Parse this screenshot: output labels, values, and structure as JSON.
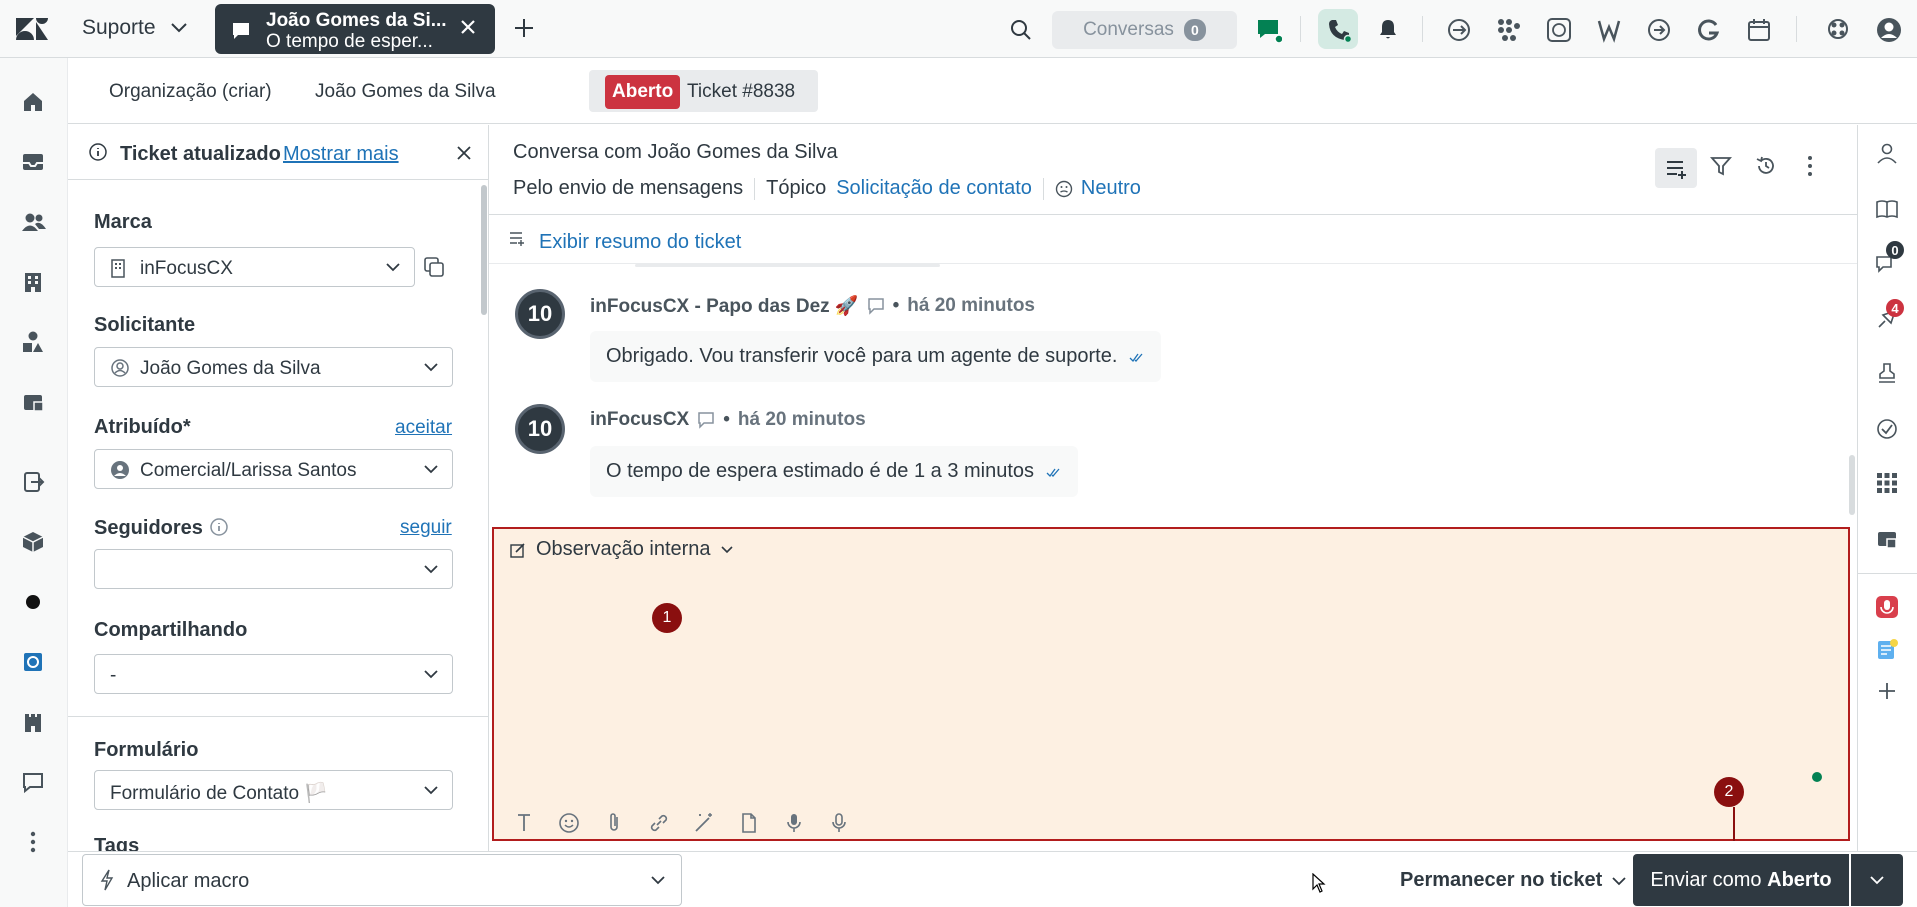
{
  "topbar": {
    "product": "Suporte",
    "tab_title": "João Gomes da Si...",
    "tab_subtitle": "O tempo de esper...",
    "conversations_label": "Conversas",
    "conversations_count": "0"
  },
  "breadcrumb": {
    "org": "Organização (criar)",
    "requester": "João Gomes da Silva",
    "status_badge": "Aberto",
    "ticket": "Ticket #8838"
  },
  "notice": {
    "text": "Ticket atualizado",
    "link": "Mostrar mais"
  },
  "props": {
    "brand_label": "Marca",
    "brand_value": "inFocusCX",
    "requester_label": "Solicitante",
    "requester_value": "João Gomes da Silva",
    "assignee_label": "Atribuído*",
    "assignee_link": "aceitar",
    "assignee_value": "Comercial/Larissa Santos",
    "followers_label": "Seguidores",
    "followers_link": "seguir",
    "followers_value": "",
    "sharing_label": "Compartilhando",
    "sharing_value": "-",
    "form_label": "Formulário",
    "form_value": "Formulário de Contato 🏳️",
    "tags_label": "Tags"
  },
  "conversation": {
    "title": "Conversa com João Gomes da Silva",
    "channel": "Pelo envio de mensagens",
    "topic_label": "Tópico",
    "topic_value": "Solicitação de contato",
    "sentiment": "Neutro",
    "summary_link": "Exibir resumo do ticket",
    "messages": [
      {
        "avatar": "10",
        "author": "inFocusCX - Papo das Dez 🚀",
        "time": "há 20 minutos",
        "text": "Obrigado. Vou transferir você para um agente de suporte."
      },
      {
        "avatar": "10",
        "author": "inFocusCX",
        "time": "há 20 minutos",
        "text": "O tempo de espera estimado é de 1 a 3 minutos"
      }
    ]
  },
  "composer": {
    "mode": "Observação interna",
    "marker1": "1",
    "marker2": "2"
  },
  "rightrail": {
    "chat_badge": "0",
    "apps_badge": "4"
  },
  "bottombar": {
    "macro_placeholder": "Aplicar macro",
    "stay_label": "Permanecer no ticket",
    "send_prefix": "Enviar como ",
    "send_status": "Aberto"
  },
  "colors": {
    "accent_blue": "#1f73b7",
    "open_red": "#cc3340",
    "composer_bg": "#fdf0e2",
    "highlight_border": "#b21d1d",
    "dark": "#2f3941"
  }
}
